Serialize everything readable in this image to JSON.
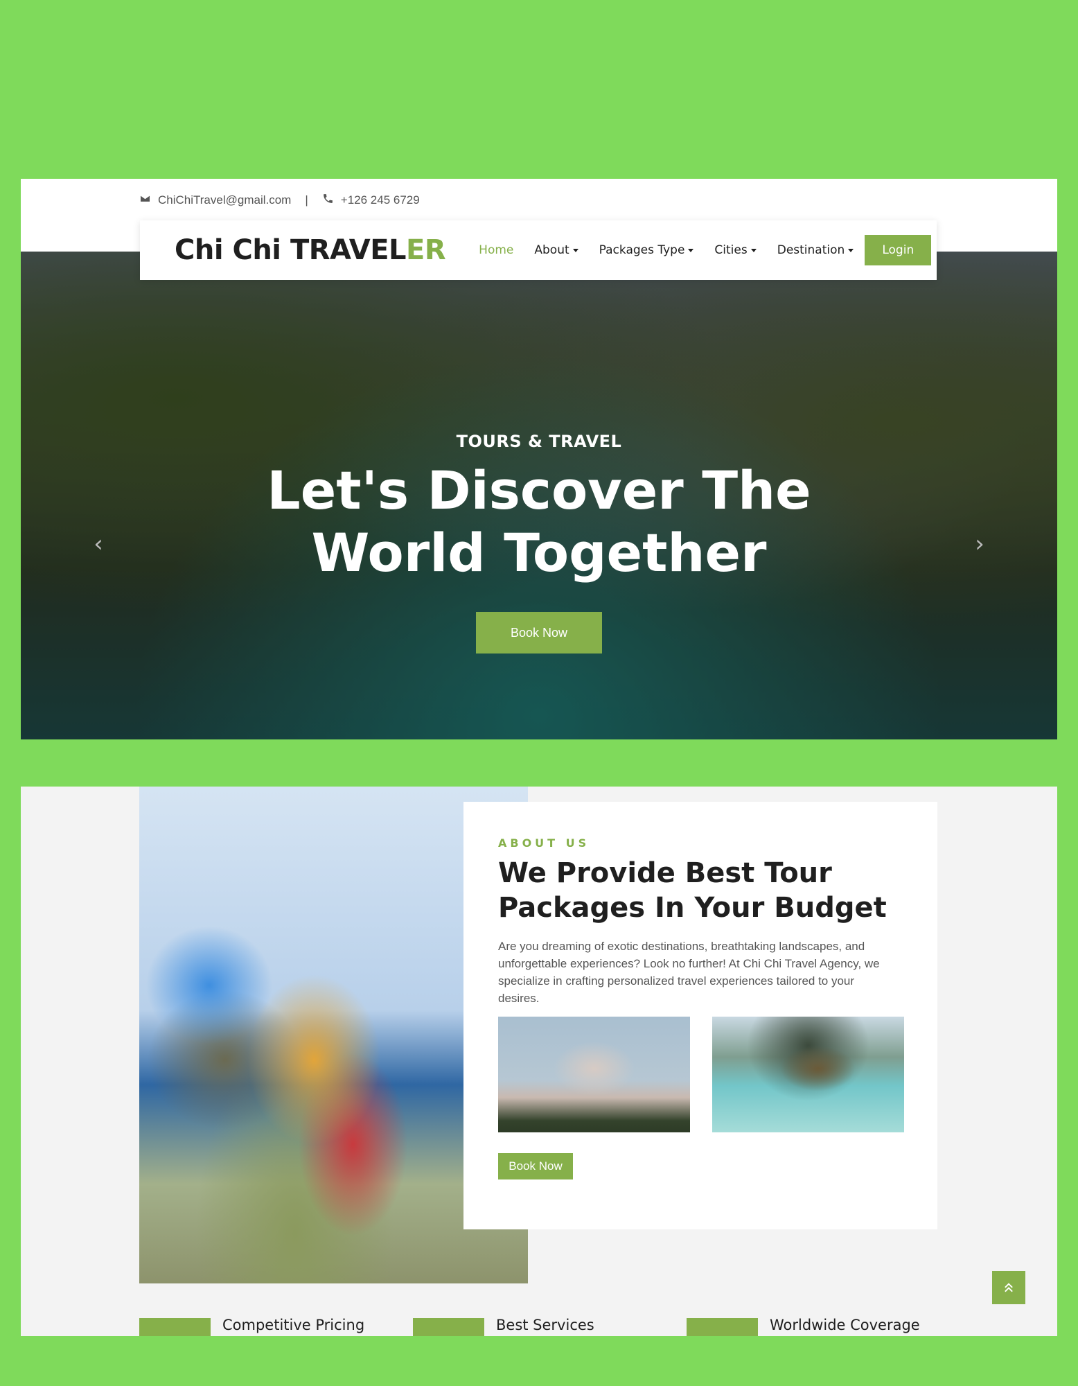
{
  "topbar": {
    "email": "ChiChiTravel@gmail.com",
    "separator": "|",
    "phone": "+126 245 6729"
  },
  "navbar": {
    "brand_main": "Chi Chi TRAVEL",
    "brand_accent": "ER",
    "items": [
      {
        "label": "Home",
        "active": true,
        "dropdown": false
      },
      {
        "label": "About",
        "active": false,
        "dropdown": true
      },
      {
        "label": "Packages Type",
        "active": false,
        "dropdown": true
      },
      {
        "label": "Cities",
        "active": false,
        "dropdown": true
      },
      {
        "label": "Destination",
        "active": false,
        "dropdown": true
      }
    ],
    "login_label": "Login"
  },
  "hero": {
    "subtitle": "TOURS & TRAVEL",
    "title": "Let's Discover The\nWorld Together",
    "button_label": "Book Now",
    "prev_icon": "chevron-left-icon",
    "next_icon": "chevron-right-icon"
  },
  "about": {
    "label": "ABOUT US",
    "title": "We Provide Best Tour\nPackages In Your Budget",
    "text": "Are you dreaming of exotic destinations, breathtaking landscapes, and unforgettable experiences? Look no further! At Chi Chi Travel Agency, we specialize in crafting personalized travel experiences tailored to your desires.",
    "button_label": "Book Now"
  },
  "features": [
    {
      "label": "Competitive Pricing"
    },
    {
      "label": "Best Services"
    },
    {
      "label": "Worldwide Coverage"
    }
  ],
  "colors": {
    "background": "#7fda5b",
    "accent": "#86b04a",
    "text_dark": "#1f1f1f",
    "text_muted": "#555555"
  },
  "icons": {
    "email": "envelope-icon",
    "phone": "phone-icon",
    "scroll_top": "double-chevron-up-icon"
  }
}
